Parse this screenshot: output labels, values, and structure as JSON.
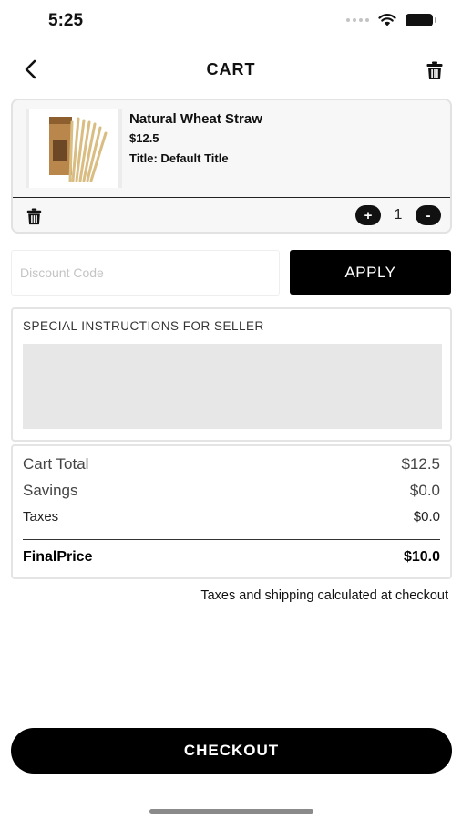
{
  "status_bar": {
    "time": "5:25",
    "icons": [
      "cellular-signal-icon",
      "wifi-icon",
      "battery-icon"
    ]
  },
  "header": {
    "title": "CART",
    "back_icon": "chevron-left-icon",
    "trash_icon": "trash-icon"
  },
  "cart_item": {
    "image_icon": "wheat-straw-product-image",
    "name": "Natural Wheat Straw",
    "price": "$12.5",
    "variant": "Title: Default Title",
    "quantity": "1",
    "increment_label": "+",
    "decrement_label": "-"
  },
  "discount": {
    "placeholder": "Discount Code",
    "value": "",
    "apply_label": "APPLY"
  },
  "instructions": {
    "label": "SPECIAL INSTRUCTIONS FOR SELLER",
    "value": ""
  },
  "totals": {
    "cart_total_label": "Cart Total",
    "cart_total_value": "$12.5",
    "savings_label": "Savings",
    "savings_value": "$0.0",
    "taxes_label": "Taxes",
    "taxes_value": "$0.0",
    "final_label": "FinalPrice",
    "final_value": "$10.0"
  },
  "tax_note": "Taxes and shipping calculated at checkout",
  "checkout_label": "CHECKOUT",
  "colors": {
    "primary": "#000000",
    "card_background": "#f7f7f7",
    "field_background": "#e7e7e7",
    "border": "#e4e4e4"
  }
}
